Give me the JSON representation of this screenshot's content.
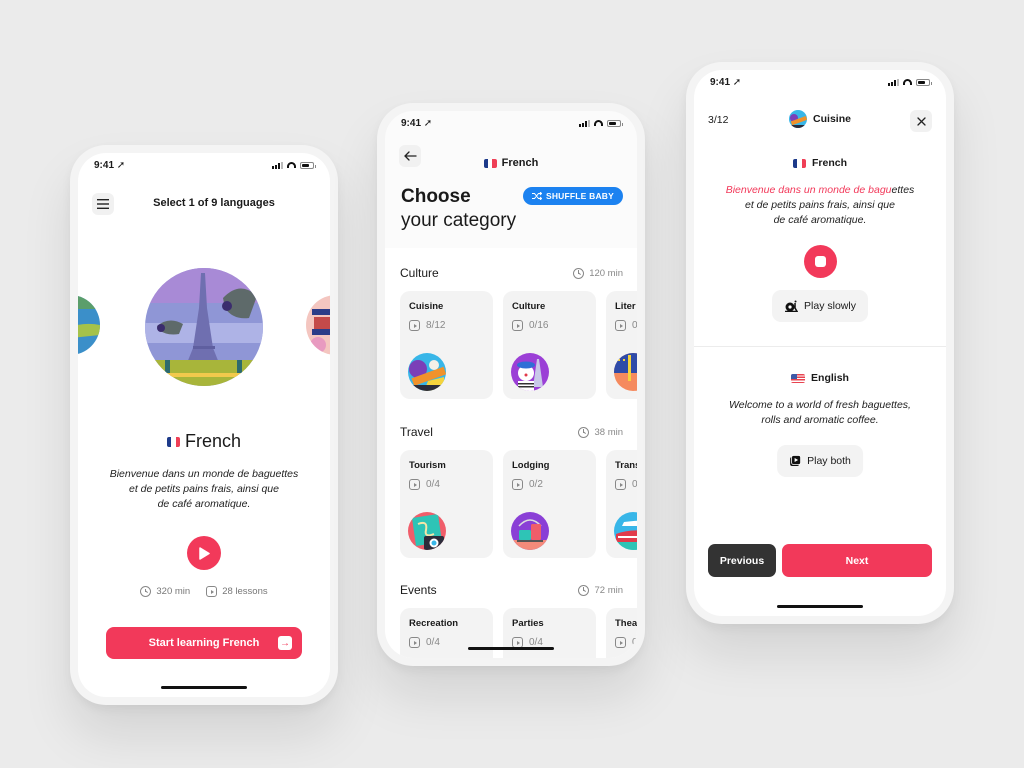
{
  "colors": {
    "accent": "#f2395a",
    "shuffle_blue": "#1c82f0",
    "dark_button": "#333333",
    "background": "#ebebeb"
  },
  "status_bar": {
    "time": "9:41",
    "location_icon": "location-arrow-icon",
    "signal_icon": "signal-icon",
    "wifi_icon": "wifi-icon",
    "battery_icon": "battery-icon"
  },
  "screen_language_select": {
    "menu_icon": "hamburger-menu-icon",
    "title": "Select 1 of 9 languages",
    "carousel": [
      {
        "name": "previous-language-illustration",
        "position": "left-partial"
      },
      {
        "name": "paris-eiffel-tower-illustration",
        "position": "center",
        "selected": true
      },
      {
        "name": "next-language-illustration",
        "position": "right-partial"
      }
    ],
    "language": {
      "flag": "france-flag-icon",
      "name": "French"
    },
    "phrase_lines": [
      "Bienvenue dans un monde de baguettes",
      "et de petits pains frais, ainsi que",
      "de café aromatique."
    ],
    "play_icon": "play-icon",
    "duration": "320 min",
    "lessons": "28 lessons",
    "cta_label": "Start learning French",
    "cta_icon": "arrow-right-icon"
  },
  "screen_category": {
    "back_icon": "arrow-left-icon",
    "nav_title": "French",
    "heading_line1": "Choose",
    "heading_line2": "your category",
    "shuffle_label": "SHUFFLE BABY",
    "shuffle_icon": "shuffle-icon",
    "sections": [
      {
        "name": "Culture",
        "duration": "120 min",
        "cards": [
          {
            "title": "Cuisine",
            "progress": "8/12",
            "art": "cuisine-illustration"
          },
          {
            "title": "Culture",
            "progress": "0/16",
            "art": "mime-eiffel-illustration"
          },
          {
            "title": "Liter",
            "progress": "0",
            "art": "literature-illustration"
          }
        ]
      },
      {
        "name": "Travel",
        "duration": "38 min",
        "cards": [
          {
            "title": "Tourism",
            "progress": "0/4",
            "art": "map-camera-illustration"
          },
          {
            "title": "Lodging",
            "progress": "0/2",
            "art": "luggage-cart-illustration"
          },
          {
            "title": "Trans",
            "progress": "0",
            "art": "train-plane-illustration"
          }
        ]
      },
      {
        "name": "Events",
        "duration": "72 min",
        "cards": [
          {
            "title": "Recreation",
            "progress": "0/4",
            "art": ""
          },
          {
            "title": "Parties",
            "progress": "0/4",
            "art": ""
          },
          {
            "title": "Thea",
            "progress": "0",
            "art": ""
          }
        ]
      }
    ]
  },
  "screen_lesson": {
    "counter": "3/12",
    "lesson_title": "Cuisine",
    "close_icon": "close-icon",
    "source_language": "French",
    "source_phrase": {
      "highlighted": "Bienvenue dans un monde de bagu",
      "rest_line1": "ettes",
      "line2": "et de petits pains frais, ainsi que",
      "line3": "de café aromatique."
    },
    "stop_icon": "stop-icon",
    "play_slowly_label": "Play slowly",
    "play_slowly_icon": "snail-icon",
    "target_language": "English",
    "target_phrase_lines": [
      "Welcome to a world of fresh baguettes,",
      "rolls and aromatic coffee."
    ],
    "play_both_label": "Play both",
    "play_both_icon": "play-both-icon",
    "previous_label": "Previous",
    "next_label": "Next"
  }
}
